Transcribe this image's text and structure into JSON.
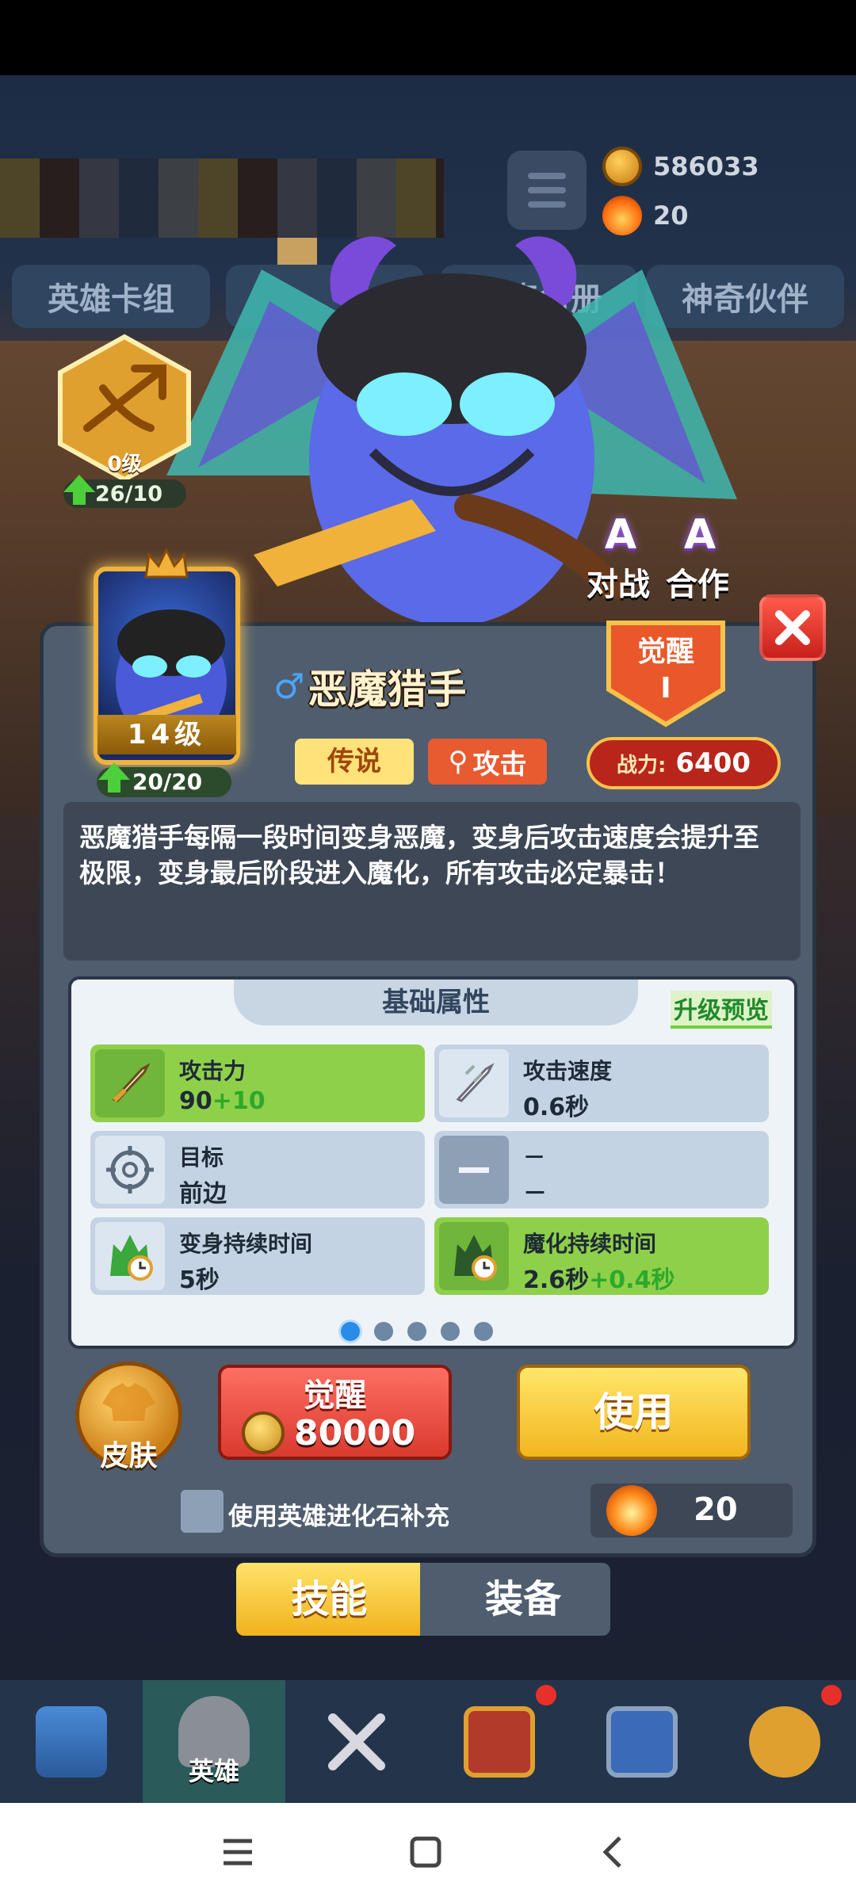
{
  "currency": {
    "gold": "586033",
    "stones": "20"
  },
  "top_tabs": [
    "英雄卡组",
    "",
    "传奇名册",
    "神奇伙伴"
  ],
  "weapon": {
    "level": "0级",
    "progress": "26/10"
  },
  "modes": {
    "battle": "对战",
    "coop": "合作",
    "grade_letter": "A"
  },
  "hero": {
    "name": "恶魔猎手",
    "level": "14级",
    "progress": "20/20",
    "rarity": "传说",
    "type": "攻击",
    "awaken_label": "觉醒",
    "awaken_tier": "I",
    "power_label": "战力:",
    "power_value": "6400",
    "description": "恶魔猎手每隔一段时间变身恶魔，变身后攻击速度会提升至极限，变身最后阶段进入魔化，所有攻击必定暴击！"
  },
  "attributes": {
    "title": "基础属性",
    "preview": "升级预览",
    "items": [
      {
        "label": "攻击力",
        "value": "90",
        "bonus": "+10",
        "icon": "sword-icon"
      },
      {
        "label": "攻击速度",
        "value": "0.6秒",
        "bonus": "",
        "icon": "speed-sword-icon"
      },
      {
        "label": "目标",
        "value": "前边",
        "bonus": "",
        "icon": "target-icon"
      },
      {
        "label": "－",
        "value": "－",
        "bonus": "",
        "icon": "dash-icon"
      },
      {
        "label": "变身持续时间",
        "value": "5秒",
        "bonus": "",
        "icon": "demon-timer-icon"
      },
      {
        "label": "魔化持续时间",
        "value": "2.6秒",
        "bonus": "+0.4秒",
        "icon": "demon-timer-icon"
      }
    ],
    "page_dots": 5,
    "active_dot": 0
  },
  "actions": {
    "skin": "皮肤",
    "awaken": "觉醒",
    "awaken_cost": "80000",
    "use": "使用",
    "checkbox_label": "使用英雄进化石补充",
    "stone_count": "20"
  },
  "bottom_tabs": {
    "skill": "技能",
    "equip": "装备"
  },
  "nav": [
    {
      "icon": "chest-icon",
      "label": ""
    },
    {
      "icon": "helmet-icon",
      "label": "英雄"
    },
    {
      "icon": "swords-icon",
      "label": ""
    },
    {
      "icon": "crown-shield-icon",
      "label": ""
    },
    {
      "icon": "guild-icon",
      "label": ""
    },
    {
      "icon": "compass-icon",
      "label": ""
    }
  ],
  "colors": {
    "accent_gold": "#f2b61e",
    "danger_red": "#d93a2e",
    "bonus_green": "#2ea82a"
  }
}
